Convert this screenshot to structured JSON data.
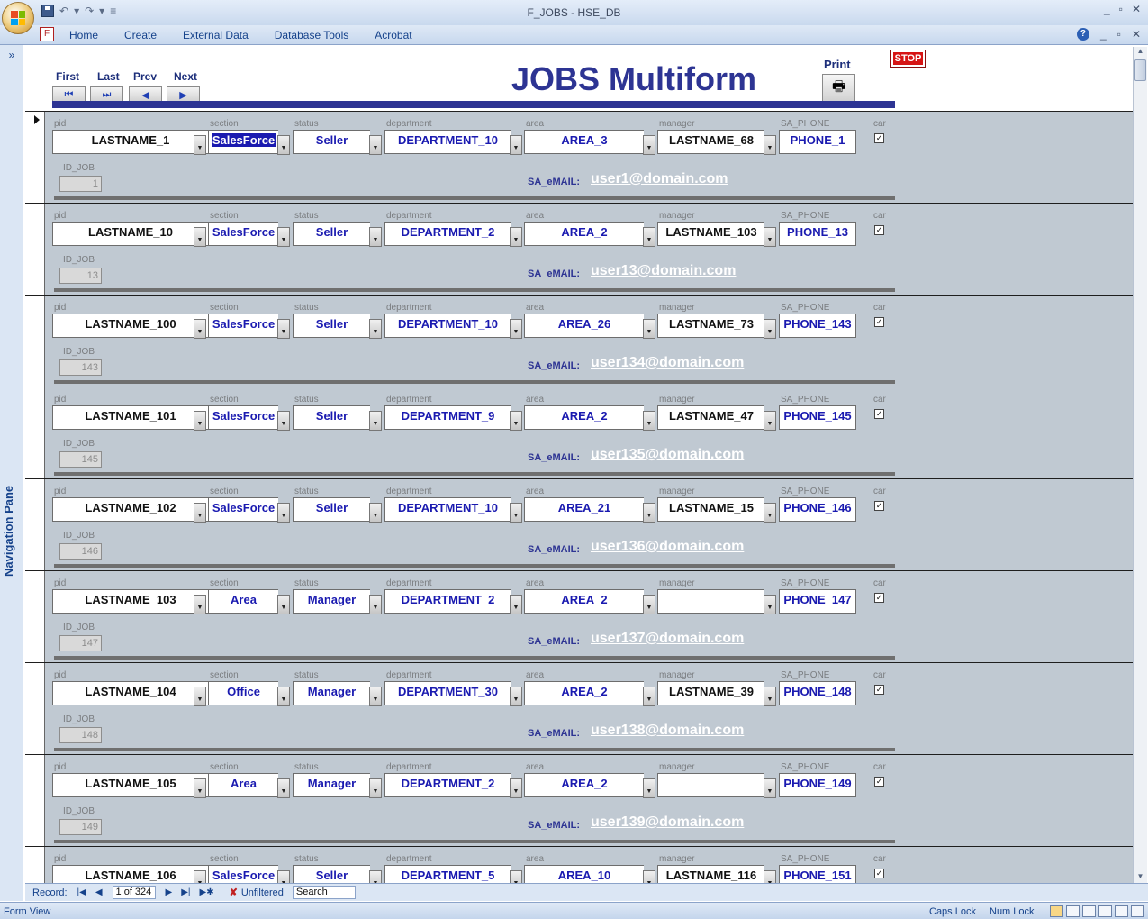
{
  "window": {
    "title": "F_JOBS - HSE_DB",
    "controls": [
      "_",
      "▫",
      "✕"
    ]
  },
  "ribbon": {
    "tabs": [
      "Home",
      "Create",
      "External Data",
      "Database Tools",
      "Acrobat"
    ],
    "controls": [
      "?",
      "_",
      "▫",
      "✕"
    ]
  },
  "nav_pane": {
    "label": "Navigation Pane",
    "toggle": "»"
  },
  "form": {
    "title": "JOBS Multiform",
    "nav_buttons": [
      {
        "label": "First",
        "glyph": "⏮"
      },
      {
        "label": "Last",
        "glyph": "⏭"
      },
      {
        "label": "Prev",
        "glyph": "◀"
      },
      {
        "label": "Next",
        "glyph": "▶"
      }
    ],
    "print_label": "Print",
    "print_glyph": "🖶",
    "stop_label": "STOP",
    "field_labels": {
      "pid": "pid",
      "section": "section",
      "status": "status",
      "department": "department",
      "area": "area",
      "manager": "manager",
      "phone": "SA_PHONE",
      "car": "car",
      "id_job": "ID_JOB",
      "email": "SA_eMAIL:"
    },
    "colors": {
      "title": "#2d3493",
      "value_blue": "#1a1ab0",
      "record_bg": "#c0c9d2"
    }
  },
  "records": [
    {
      "pid": "LASTNAME_1",
      "section": "SalesForce",
      "status": "Seller",
      "department": "DEPARTMENT_10",
      "area": "AREA_3",
      "manager": "LASTNAME_68",
      "phone": "PHONE_1",
      "car": "✓",
      "id_job": "1",
      "email": "user1@domain.com"
    },
    {
      "pid": "LASTNAME_10",
      "section": "SalesForce",
      "status": "Seller",
      "department": "DEPARTMENT_2",
      "area": "AREA_2",
      "manager": "LASTNAME_103",
      "phone": "PHONE_13",
      "car": "✓",
      "id_job": "13",
      "email": "user13@domain.com"
    },
    {
      "pid": "LASTNAME_100",
      "section": "SalesForce",
      "status": "Seller",
      "department": "DEPARTMENT_10",
      "area": "AREA_26",
      "manager": "LASTNAME_73",
      "phone": "PHONE_143",
      "car": "✓",
      "id_job": "143",
      "email": "user134@domain.com"
    },
    {
      "pid": "LASTNAME_101",
      "section": "SalesForce",
      "status": "Seller",
      "department": "DEPARTMENT_9",
      "area": "AREA_2",
      "manager": "LASTNAME_47",
      "phone": "PHONE_145",
      "car": "✓",
      "id_job": "145",
      "email": "user135@domain.com"
    },
    {
      "pid": "LASTNAME_102",
      "section": "SalesForce",
      "status": "Seller",
      "department": "DEPARTMENT_10",
      "area": "AREA_21",
      "manager": "LASTNAME_15",
      "phone": "PHONE_146",
      "car": "✓",
      "id_job": "146",
      "email": "user136@domain.com"
    },
    {
      "pid": "LASTNAME_103",
      "section": "Area",
      "status": "Manager",
      "department": "DEPARTMENT_2",
      "area": "AREA_2",
      "manager": "",
      "phone": "PHONE_147",
      "car": "✓",
      "id_job": "147",
      "email": "user137@domain.com"
    },
    {
      "pid": "LASTNAME_104",
      "section": "Office",
      "status": "Manager",
      "department": "DEPARTMENT_30",
      "area": "AREA_2",
      "manager": "LASTNAME_39",
      "phone": "PHONE_148",
      "car": "✓",
      "id_job": "148",
      "email": "user138@domain.com"
    },
    {
      "pid": "LASTNAME_105",
      "section": "Area",
      "status": "Manager",
      "department": "DEPARTMENT_2",
      "area": "AREA_2",
      "manager": "",
      "phone": "PHONE_149",
      "car": "✓",
      "id_job": "149",
      "email": "user139@domain.com"
    },
    {
      "pid": "LASTNAME_106",
      "section": "SalesForce",
      "status": "Seller",
      "department": "DEPARTMENT_5",
      "area": "AREA_10",
      "manager": "LASTNAME_116",
      "phone": "PHONE_151",
      "car": "✓",
      "id_job": "",
      "email": ""
    }
  ],
  "record_nav": {
    "label": "Record:",
    "position": "1 of 324",
    "filter_label": "Unfiltered",
    "search_label": "Search"
  },
  "status_bar": {
    "view": "Form View",
    "caps_lock": "Caps Lock",
    "num_lock": "Num Lock"
  }
}
